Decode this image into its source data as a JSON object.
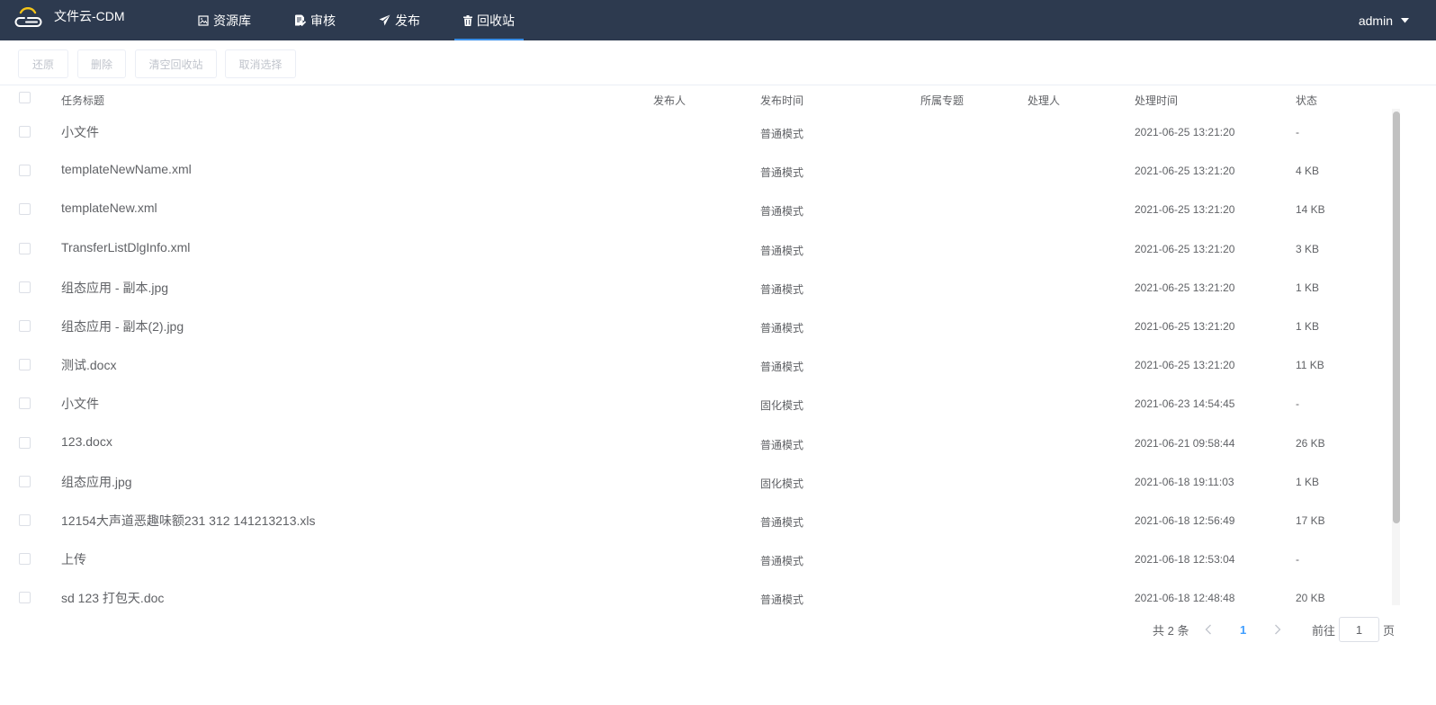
{
  "app": {
    "title": "文件云-CDM"
  },
  "nav": [
    {
      "label": "资源库",
      "icon": "picture-icon"
    },
    {
      "label": "审核",
      "icon": "document-edit-icon"
    },
    {
      "label": "发布",
      "icon": "send-icon"
    },
    {
      "label": "回收站",
      "icon": "trash-icon",
      "active": true
    }
  ],
  "user": {
    "name": "admin"
  },
  "toolbar": {
    "restore": "还原",
    "delete": "删除",
    "empty": "清空回收站",
    "deselect": "取消选择"
  },
  "columns": [
    "任务标题",
    "发布人",
    "发布时间",
    "所属专题",
    "处理人",
    "处理时间",
    "状态"
  ],
  "rows": [
    {
      "name": "小文件",
      "mode": "普通模式",
      "time": "2021-06-25 13:21:20",
      "size": "-"
    },
    {
      "name": "templateNewName.xml",
      "mode": "普通模式",
      "time": "2021-06-25 13:21:20",
      "size": "4 KB"
    },
    {
      "name": "templateNew.xml",
      "mode": "普通模式",
      "time": "2021-06-25 13:21:20",
      "size": "14 KB"
    },
    {
      "name": "TransferListDlgInfo.xml",
      "mode": "普通模式",
      "time": "2021-06-25 13:21:20",
      "size": "3 KB"
    },
    {
      "name": "组态应用 - 副本.jpg",
      "mode": "普通模式",
      "time": "2021-06-25 13:21:20",
      "size": "1 KB"
    },
    {
      "name": "组态应用 - 副本(2).jpg",
      "mode": "普通模式",
      "time": "2021-06-25 13:21:20",
      "size": "1 KB"
    },
    {
      "name": "测试.docx",
      "mode": "普通模式",
      "time": "2021-06-25 13:21:20",
      "size": "11 KB"
    },
    {
      "name": "小文件",
      "mode": "固化模式",
      "time": "2021-06-23 14:54:45",
      "size": "-"
    },
    {
      "name": "123.docx",
      "mode": "普通模式",
      "time": "2021-06-21 09:58:44",
      "size": "26 KB"
    },
    {
      "name": "组态应用.jpg",
      "mode": "固化模式",
      "time": "2021-06-18 19:11:03",
      "size": "1 KB"
    },
    {
      "name": "12154大声道恶趣味额231 312 141213213.xls",
      "mode": "普通模式",
      "time": "2021-06-18 12:56:49",
      "size": "17 KB"
    },
    {
      "name": "上传",
      "mode": "普通模式",
      "time": "2021-06-18 12:53:04",
      "size": "-"
    },
    {
      "name": "sd 123 打包天.doc",
      "mode": "普通模式",
      "time": "2021-06-18 12:48:48",
      "size": "20 KB"
    }
  ],
  "pagination": {
    "total": "共 2 条",
    "current": "1",
    "goto_prefix": "前往",
    "goto_suffix": "页",
    "goto_value": "1"
  },
  "colors": {
    "header_bg": "#2d3a4f",
    "active_underline": "#3a8ee6",
    "pager_active": "#409eff",
    "logo_accent": "#f5c518"
  }
}
